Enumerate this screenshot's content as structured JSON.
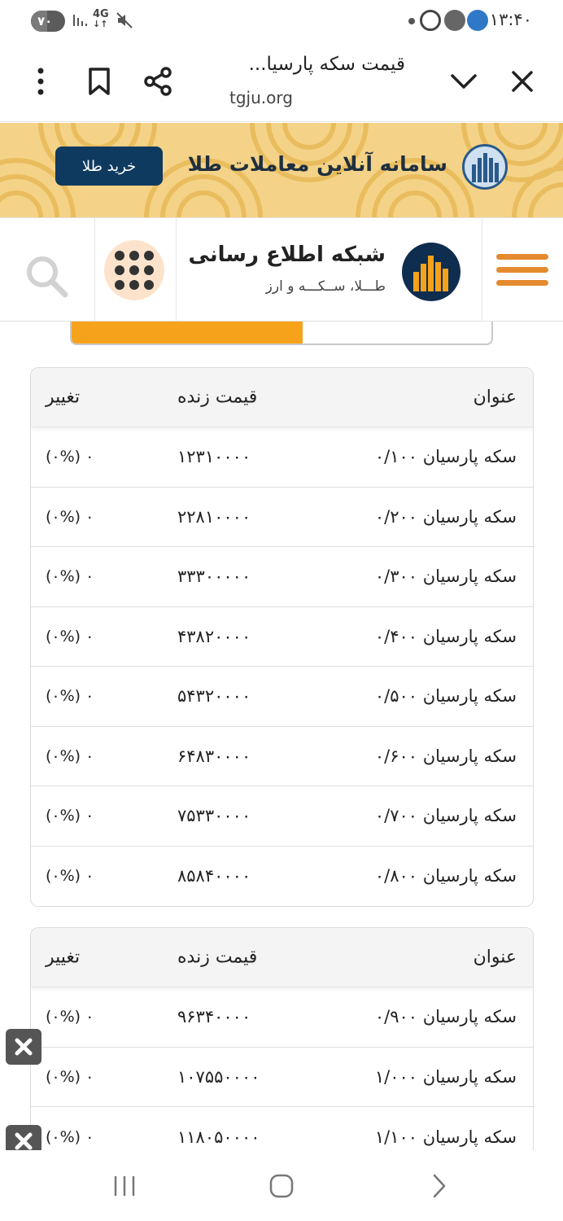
{
  "status_bar": {
    "battery": "۷۰",
    "network": "4G",
    "time": "۱۳:۴۰"
  },
  "browser": {
    "page_title": "قیمت سکه پارسیا...",
    "domain": "tgju.org",
    "icons": [
      "more-vert-icon",
      "bookmark-icon",
      "share-icon",
      "chevron-down-icon",
      "close-icon"
    ]
  },
  "banner": {
    "text": "سامانه آنلاین معاملات طلا",
    "button_label": "خرید طلا",
    "colors": {
      "background": "#f4d388",
      "button": "#0e3a5f"
    }
  },
  "site_header": {
    "name": "شبکه اطلاع رسانی",
    "tagline": "طـــلا، ســکـــه و ارز",
    "icons": [
      "menu-icon",
      "site-logo",
      "apps-grid-icon",
      "search-icon"
    ],
    "accent": "#e58a2e"
  },
  "progress": {
    "fill_fraction": 0.55,
    "color": "#f7a21b"
  },
  "tables": [
    {
      "headers": {
        "title": "عنوان",
        "price": "قیمت زنده",
        "change": "تغییر"
      },
      "rows": [
        {
          "title": "سکه پارسیان ۰/۱۰۰",
          "price": "۱۲۳۱۰۰۰۰",
          "change": "(۰%) ۰"
        },
        {
          "title": "سکه پارسیان ۰/۲۰۰",
          "price": "۲۲۸۱۰۰۰۰",
          "change": "(۰%) ۰"
        },
        {
          "title": "سکه پارسیان ۰/۳۰۰",
          "price": "۳۳۳۰۰۰۰۰",
          "change": "(۰%) ۰"
        },
        {
          "title": "سکه پارسیان ۰/۴۰۰",
          "price": "۴۳۸۲۰۰۰۰",
          "change": "(۰%) ۰"
        },
        {
          "title": "سکه پارسیان ۰/۵۰۰",
          "price": "۵۴۳۲۰۰۰۰",
          "change": "(۰%) ۰"
        },
        {
          "title": "سکه پارسیان ۰/۶۰۰",
          "price": "۶۴۸۳۰۰۰۰",
          "change": "(۰%) ۰"
        },
        {
          "title": "سکه پارسیان ۰/۷۰۰",
          "price": "۷۵۳۳۰۰۰۰",
          "change": "(۰%) ۰"
        },
        {
          "title": "سکه پارسیان ۰/۸۰۰",
          "price": "۸۵۸۴۰۰۰۰",
          "change": "(۰%) ۰"
        }
      ]
    },
    {
      "headers": {
        "title": "عنوان",
        "price": "قیمت زنده",
        "change": "تغییر"
      },
      "rows": [
        {
          "title": "سکه پارسیان ۰/۹۰۰",
          "price": "۹۶۳۴۰۰۰۰",
          "change": "(۰%) ۰"
        },
        {
          "title": "سکه پارسیان ۱/۰۰۰",
          "price": "۱۰۷۵۵۰۰۰۰",
          "change": "(۰%) ۰"
        },
        {
          "title": "سکه پارسیان ۱/۱۰۰",
          "price": "۱۱۸۰۵۰۰۰۰",
          "change": "(۰%) ۰"
        }
      ]
    }
  ],
  "nav_bar": {
    "icons": [
      "recents-icon",
      "home-icon",
      "back-icon"
    ]
  }
}
